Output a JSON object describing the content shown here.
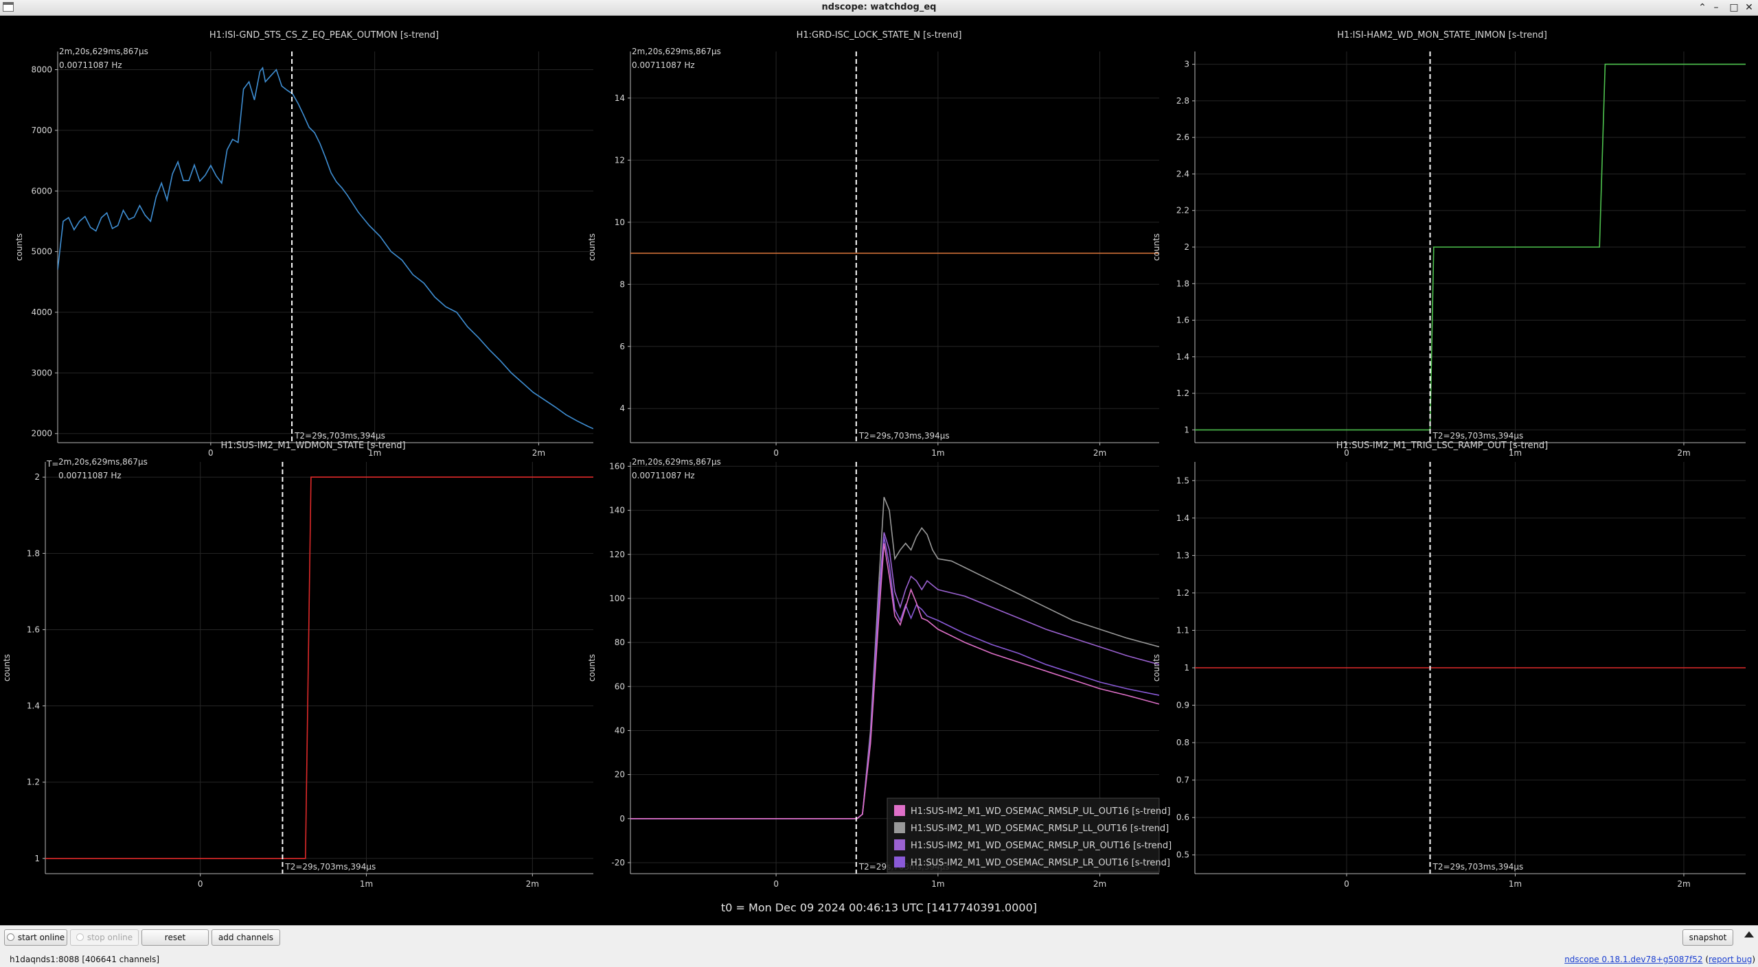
{
  "window": {
    "title": "ndscope: watchdog_eq",
    "icons": [
      "app-icon",
      "chevron-up-icon",
      "minimize-icon",
      "maximize-icon",
      "close-icon"
    ]
  },
  "global_time_label": "t0 = Mon Dec 09 2024 00:46:13 UTC [1417740391.0000]",
  "cursor_labels": {
    "t1": "2m,20s,629ms,867μs",
    "freq": "0.00711087 Hz",
    "t2": "T2=29s,703ms,394μs",
    "t_prefix": "T="
  },
  "colors": {
    "background": "#000000",
    "grid": "#262626",
    "axis": "#bdbdbd",
    "cursor": "#ffffff",
    "blue": "#3f8fd4",
    "orange": "#e0783a",
    "green": "#4ec24e",
    "red": "#e02a2a",
    "pink": "#e070c9",
    "gray": "#9a9a9a",
    "purple": "#9b62d1",
    "violet": "#8a5ad8"
  },
  "chart_data": [
    {
      "type": "line",
      "title": "H1:ISI-GND_STS_CS_Z_EQ_PEAK_OUTMON [s-trend]",
      "ylabel": "counts",
      "x_ticks": [
        {
          "v": 0,
          "label": "0"
        },
        {
          "v": 60,
          "label": "1m"
        },
        {
          "v": 120,
          "label": "2m"
        }
      ],
      "xlim": [
        -56,
        140
      ],
      "ylim": [
        1850,
        8300
      ],
      "y_ticks": [
        2000,
        3000,
        4000,
        5000,
        6000,
        7000,
        8000
      ],
      "show_t1": true,
      "show_freq": true,
      "t_prefix": false,
      "series": [
        {
          "color": "blue",
          "points": [
            [
              -56,
              4700
            ],
            [
              -54,
              5500
            ],
            [
              -52,
              5560
            ],
            [
              -50,
              5360
            ],
            [
              -48,
              5500
            ],
            [
              -46,
              5580
            ],
            [
              -44,
              5400
            ],
            [
              -42,
              5340
            ],
            [
              -40,
              5560
            ],
            [
              -38,
              5640
            ],
            [
              -36,
              5380
            ],
            [
              -34,
              5430
            ],
            [
              -32,
              5680
            ],
            [
              -30,
              5530
            ],
            [
              -28,
              5570
            ],
            [
              -26,
              5760
            ],
            [
              -24,
              5600
            ],
            [
              -22,
              5500
            ],
            [
              -20,
              5900
            ],
            [
              -18,
              6130
            ],
            [
              -16,
              5850
            ],
            [
              -14,
              6280
            ],
            [
              -12,
              6480
            ],
            [
              -10,
              6170
            ],
            [
              -8,
              6170
            ],
            [
              -6,
              6430
            ],
            [
              -4,
              6160
            ],
            [
              -2,
              6260
            ],
            [
              0,
              6420
            ],
            [
              2,
              6250
            ],
            [
              4,
              6130
            ],
            [
              6,
              6680
            ],
            [
              8,
              6850
            ],
            [
              10,
              6800
            ],
            [
              12,
              7680
            ],
            [
              14,
              7800
            ],
            [
              16,
              7500
            ],
            [
              18,
              7970
            ],
            [
              19,
              8030
            ],
            [
              20,
              7800
            ],
            [
              22,
              7900
            ],
            [
              24,
              8000
            ],
            [
              26,
              7730
            ],
            [
              28,
              7660
            ],
            [
              30,
              7600
            ],
            [
              32,
              7440
            ],
            [
              34,
              7250
            ],
            [
              36,
              7050
            ],
            [
              38,
              6960
            ],
            [
              40,
              6780
            ],
            [
              42,
              6550
            ],
            [
              44,
              6300
            ],
            [
              46,
              6150
            ],
            [
              48,
              6050
            ],
            [
              50,
              5930
            ],
            [
              54,
              5650
            ],
            [
              58,
              5430
            ],
            [
              62,
              5250
            ],
            [
              66,
              5000
            ],
            [
              70,
              4860
            ],
            [
              74,
              4620
            ],
            [
              78,
              4480
            ],
            [
              82,
              4250
            ],
            [
              86,
              4090
            ],
            [
              90,
              4000
            ],
            [
              94,
              3760
            ],
            [
              98,
              3580
            ],
            [
              102,
              3380
            ],
            [
              106,
              3200
            ],
            [
              110,
              3000
            ],
            [
              114,
              2840
            ],
            [
              118,
              2680
            ],
            [
              122,
              2560
            ],
            [
              126,
              2440
            ],
            [
              130,
              2310
            ],
            [
              134,
              2210
            ],
            [
              138,
              2120
            ],
            [
              140,
              2080
            ]
          ]
        }
      ]
    },
    {
      "type": "line",
      "title": "H1:GRD-ISC_LOCK_STATE_N [s-trend]",
      "ylabel": "counts",
      "x_ticks": [
        {
          "v": 0,
          "label": "0"
        },
        {
          "v": 60,
          "label": "1m"
        },
        {
          "v": 120,
          "label": "2m"
        }
      ],
      "xlim": [
        -54,
        142
      ],
      "ylim": [
        2.9,
        15.5
      ],
      "y_ticks": [
        4,
        6,
        8,
        10,
        12,
        14
      ],
      "show_t1": true,
      "show_freq": true,
      "t_prefix": false,
      "series": [
        {
          "color": "orange",
          "points": [
            [
              -54,
              9
            ],
            [
              142,
              9
            ]
          ]
        }
      ]
    },
    {
      "type": "line",
      "title": "H1:ISI-HAM2_WD_MON_STATE_INMON [s-trend]",
      "ylabel": "counts",
      "x_ticks": [
        {
          "v": 0,
          "label": "0"
        },
        {
          "v": 60,
          "label": "1m"
        },
        {
          "v": 120,
          "label": "2m"
        }
      ],
      "xlim": [
        -54,
        142
      ],
      "ylim": [
        0.93,
        3.07
      ],
      "y_ticks": [
        1,
        1.2,
        1.4,
        1.6,
        1.8,
        2,
        2.2,
        2.4,
        2.6,
        2.8,
        3
      ],
      "show_t1": false,
      "show_freq": false,
      "t_prefix": false,
      "series": [
        {
          "color": "green",
          "points": [
            [
              -54,
              1
            ],
            [
              29.7,
              1
            ],
            [
              31,
              2
            ],
            [
              90,
              2
            ],
            [
              92,
              3
            ],
            [
              142,
              3
            ]
          ]
        }
      ]
    },
    {
      "type": "line",
      "title": "H1:SUS-IM2_M1_WDMON_STATE [s-trend]",
      "ylabel": "counts",
      "x_ticks": [
        {
          "v": 0,
          "label": "0"
        },
        {
          "v": 60,
          "label": "1m"
        },
        {
          "v": 120,
          "label": "2m"
        }
      ],
      "xlim": [
        -56,
        142
      ],
      "ylim": [
        0.96,
        2.04
      ],
      "y_ticks": [
        1,
        1.2,
        1.4,
        1.6,
        1.8,
        2
      ],
      "show_t1": true,
      "show_freq": true,
      "t_prefix": true,
      "series": [
        {
          "color": "red",
          "points": [
            [
              -56,
              1
            ],
            [
              38,
              1
            ],
            [
              40,
              2
            ],
            [
              142,
              2
            ]
          ]
        }
      ]
    },
    {
      "type": "line",
      "title": "",
      "ylabel": "counts",
      "x_ticks": [
        {
          "v": 0,
          "label": "0"
        },
        {
          "v": 60,
          "label": "1m"
        },
        {
          "v": 120,
          "label": "2m"
        }
      ],
      "xlim": [
        -54,
        142
      ],
      "ylim": [
        -25,
        162
      ],
      "y_ticks": [
        -20,
        0,
        20,
        40,
        60,
        80,
        100,
        120,
        140,
        160
      ],
      "show_t1": true,
      "show_freq": true,
      "t_prefix": false,
      "legend": {
        "position": "bottom-right",
        "entries": [
          {
            "name": "H1:SUS-IM2_M1_WD_OSEMAC_RMSLP_UL_OUT16 [s-trend]",
            "color": "pink"
          },
          {
            "name": "H1:SUS-IM2_M1_WD_OSEMAC_RMSLP_LL_OUT16 [s-trend]",
            "color": "gray"
          },
          {
            "name": "H1:SUS-IM2_M1_WD_OSEMAC_RMSLP_UR_OUT16 [s-trend]",
            "color": "purple"
          },
          {
            "name": "H1:SUS-IM2_M1_WD_OSEMAC_RMSLP_LR_OUT16 [s-trend]",
            "color": "violet"
          }
        ]
      },
      "series": [
        {
          "color": "gray",
          "points": [
            [
              -54,
              0
            ],
            [
              30,
              0
            ],
            [
              32,
              2
            ],
            [
              35,
              40
            ],
            [
              38,
              105
            ],
            [
              40,
              146
            ],
            [
              42,
              140
            ],
            [
              44,
              118
            ],
            [
              46,
              122
            ],
            [
              48,
              125
            ],
            [
              50,
              122
            ],
            [
              52,
              128
            ],
            [
              54,
              132
            ],
            [
              56,
              129
            ],
            [
              58,
              122
            ],
            [
              60,
              118
            ],
            [
              65,
              117
            ],
            [
              70,
              114
            ],
            [
              80,
              108
            ],
            [
              90,
              102
            ],
            [
              100,
              96
            ],
            [
              110,
              90
            ],
            [
              120,
              86
            ],
            [
              130,
              82
            ],
            [
              142,
              78
            ]
          ]
        },
        {
          "color": "purple",
          "points": [
            [
              -54,
              0
            ],
            [
              30,
              0
            ],
            [
              32,
              2
            ],
            [
              35,
              38
            ],
            [
              38,
              100
            ],
            [
              40,
              130
            ],
            [
              42,
              122
            ],
            [
              44,
              103
            ],
            [
              46,
              96
            ],
            [
              48,
              104
            ],
            [
              50,
              110
            ],
            [
              52,
              108
            ],
            [
              54,
              104
            ],
            [
              56,
              108
            ],
            [
              58,
              106
            ],
            [
              60,
              104
            ],
            [
              70,
              101
            ],
            [
              80,
              96
            ],
            [
              90,
              91
            ],
            [
              100,
              86
            ],
            [
              110,
              82
            ],
            [
              120,
              78
            ],
            [
              130,
              74
            ],
            [
              142,
              70
            ]
          ]
        },
        {
          "color": "violet",
          "points": [
            [
              -54,
              0
            ],
            [
              30,
              0
            ],
            [
              32,
              2
            ],
            [
              35,
              36
            ],
            [
              38,
              96
            ],
            [
              40,
              128
            ],
            [
              42,
              115
            ],
            [
              44,
              95
            ],
            [
              46,
              90
            ],
            [
              48,
              97
            ],
            [
              50,
              91
            ],
            [
              52,
              97
            ],
            [
              54,
              95
            ],
            [
              56,
              92
            ],
            [
              60,
              90
            ],
            [
              70,
              84
            ],
            [
              80,
              79
            ],
            [
              90,
              75
            ],
            [
              100,
              70
            ],
            [
              110,
              66
            ],
            [
              120,
              62
            ],
            [
              130,
              59
            ],
            [
              142,
              56
            ]
          ]
        },
        {
          "color": "pink",
          "points": [
            [
              -54,
              0
            ],
            [
              30,
              0
            ],
            [
              32,
              2
            ],
            [
              35,
              34
            ],
            [
              38,
              90
            ],
            [
              40,
              125
            ],
            [
              42,
              110
            ],
            [
              44,
              92
            ],
            [
              46,
              88
            ],
            [
              48,
              96
            ],
            [
              50,
              104
            ],
            [
              52,
              98
            ],
            [
              54,
              91
            ],
            [
              56,
              90
            ],
            [
              60,
              86
            ],
            [
              70,
              80
            ],
            [
              80,
              75
            ],
            [
              90,
              71
            ],
            [
              100,
              67
            ],
            [
              110,
              63
            ],
            [
              120,
              59
            ],
            [
              130,
              56
            ],
            [
              142,
              52
            ]
          ]
        }
      ]
    },
    {
      "type": "line",
      "title": "H1:SUS-IM2_M1_TRIG_LSC_RAMP_OUT [s-trend]",
      "ylabel": "counts",
      "x_ticks": [
        {
          "v": 0,
          "label": "0"
        },
        {
          "v": 60,
          "label": "1m"
        },
        {
          "v": 120,
          "label": "2m"
        }
      ],
      "xlim": [
        -54,
        142
      ],
      "ylim": [
        0.45,
        1.55
      ],
      "y_ticks": [
        0.5,
        0.6,
        0.7,
        0.8,
        0.9,
        1,
        1.1,
        1.2,
        1.3,
        1.4,
        1.5
      ],
      "show_t1": false,
      "show_freq": false,
      "t_prefix": false,
      "series": [
        {
          "color": "red",
          "points": [
            [
              -54,
              1
            ],
            [
              142,
              1
            ]
          ]
        }
      ]
    }
  ],
  "toolbar": {
    "start_online": "start online",
    "stop_online": "stop online",
    "reset": "reset",
    "add_channels": "add channels",
    "snapshot": "snapshot"
  },
  "status": {
    "server": "h1daqnds1:8088  [406641 channels]",
    "version": "ndscope 0.18.1.dev78+g5087f52",
    "report_bug": "report bug"
  }
}
